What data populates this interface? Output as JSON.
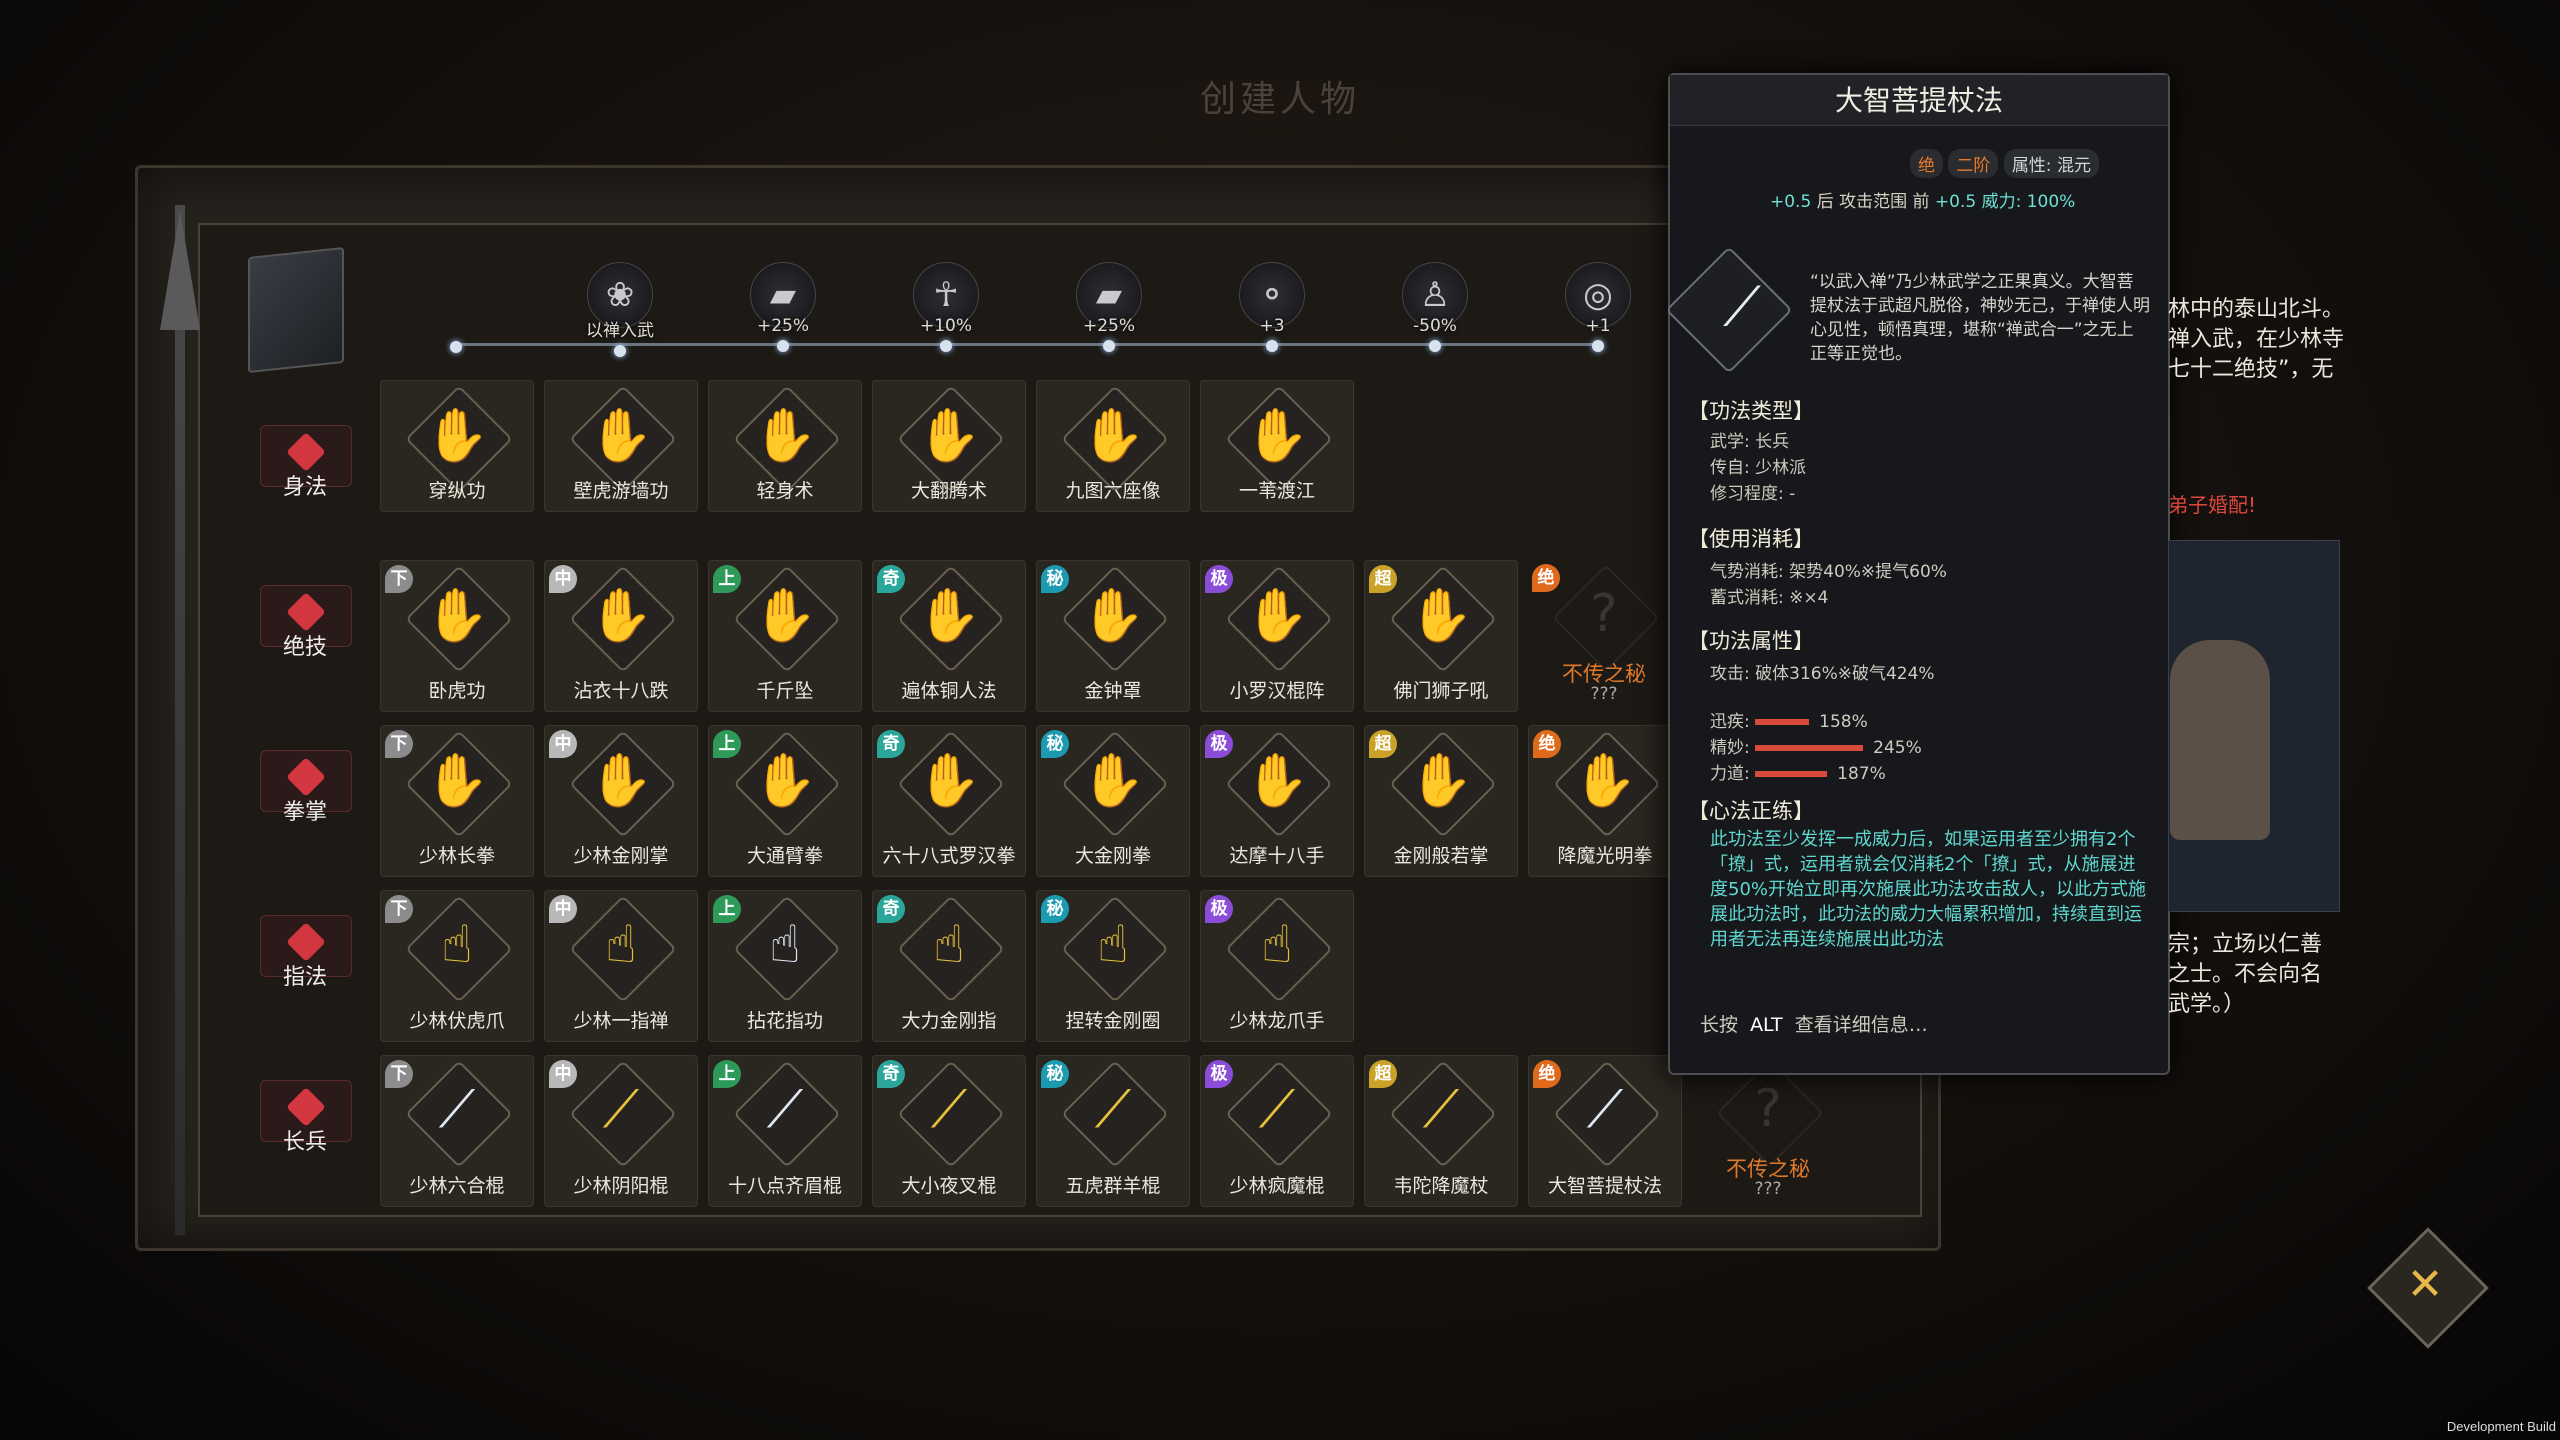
{
  "page_title": "创建人物",
  "stages": [
    {
      "icon": "lotus-icon",
      "label": "以禅入武",
      "glyph": "❀"
    },
    {
      "icon": "book-icon",
      "label": "+25%",
      "glyph": "▰"
    },
    {
      "icon": "meditation-icon",
      "label": "+10%",
      "glyph": "☥"
    },
    {
      "icon": "scroll-icon",
      "label": "+25%",
      "glyph": "▰"
    },
    {
      "icon": "nodes-icon",
      "label": "+3",
      "glyph": "⚬"
    },
    {
      "icon": "figure-icon",
      "label": "-50%",
      "glyph": "♙"
    },
    {
      "icon": "cloud-icon",
      "label": "+1",
      "glyph": "◎"
    }
  ],
  "categories": [
    "身法",
    "绝技",
    "拳掌",
    "指法",
    "长兵"
  ],
  "tiers": {
    "xia": "下",
    "zhong": "中",
    "shang": "上",
    "qi": "奇",
    "mi": "秘",
    "ji": "极",
    "chao": "超",
    "jue": "绝"
  },
  "tier_colors": {
    "下": "#8c8c8c",
    "中": "#b8b8b8",
    "上": "#2e9a5a",
    "奇": "#2aa79a",
    "秘": "#1c9bb0",
    "极": "#8b4dd8",
    "超": "#c9a227",
    "绝": "#e06a1c"
  },
  "rows": [
    {
      "category": "身法",
      "cards": [
        {
          "name": "穿纵功",
          "tier": "",
          "style": "white"
        },
        {
          "name": "壁虎游墙功",
          "tier": "",
          "style": "gold"
        },
        {
          "name": "轻身术",
          "tier": "",
          "style": "gold"
        },
        {
          "name": "大翻腾术",
          "tier": "",
          "style": "gold"
        },
        {
          "name": "九图六座像",
          "tier": "",
          "style": "gold"
        },
        {
          "name": "一苇渡江",
          "tier": "",
          "style": "white"
        }
      ]
    },
    {
      "category": "绝技",
      "cards": [
        {
          "name": "卧虎功",
          "tier": "下",
          "style": "gold"
        },
        {
          "name": "沾衣十八跌",
          "tier": "中",
          "style": "white"
        },
        {
          "name": "千斤坠",
          "tier": "上",
          "style": "gold"
        },
        {
          "name": "遍体铜人法",
          "tier": "奇",
          "style": "gold"
        },
        {
          "name": "金钟罩",
          "tier": "秘",
          "style": "gold"
        },
        {
          "name": "小罗汉棍阵",
          "tier": "极",
          "style": "gold"
        },
        {
          "name": "佛门狮子吼",
          "tier": "超",
          "style": "gold"
        },
        {
          "name": "不传之秘",
          "tier": "绝",
          "style": "secret",
          "q": "???"
        }
      ]
    },
    {
      "category": "拳掌",
      "cards": [
        {
          "name": "少林长拳",
          "tier": "下",
          "style": "gold"
        },
        {
          "name": "少林金刚掌",
          "tier": "中",
          "style": "gold"
        },
        {
          "name": "大通臂拳",
          "tier": "上",
          "style": "gold"
        },
        {
          "name": "六十八式罗汉拳",
          "tier": "奇",
          "style": "gold"
        },
        {
          "name": "大金刚拳",
          "tier": "秘",
          "style": "gold"
        },
        {
          "name": "达摩十八手",
          "tier": "极",
          "style": "gold"
        },
        {
          "name": "金刚般若掌",
          "tier": "超",
          "style": "gold"
        },
        {
          "name": "降魔光明拳",
          "tier": "绝",
          "style": "gold"
        }
      ]
    },
    {
      "category": "指法",
      "cards": [
        {
          "name": "少林伏虎爪",
          "tier": "下",
          "style": "gold"
        },
        {
          "name": "少林一指禅",
          "tier": "中",
          "style": "gold"
        },
        {
          "name": "拈花指功",
          "tier": "上",
          "style": "white"
        },
        {
          "name": "大力金刚指",
          "tier": "奇",
          "style": "gold"
        },
        {
          "name": "捏转金刚圈",
          "tier": "秘",
          "style": "gold"
        },
        {
          "name": "少林龙爪手",
          "tier": "极",
          "style": "gold"
        }
      ]
    },
    {
      "category": "长兵",
      "cards": [
        {
          "name": "少林六合棍",
          "tier": "下",
          "style": "white"
        },
        {
          "name": "少林阴阳棍",
          "tier": "中",
          "style": "gold"
        },
        {
          "name": "十八点齐眉棍",
          "tier": "上",
          "style": "white"
        },
        {
          "name": "大小夜叉棍",
          "tier": "奇",
          "style": "gold"
        },
        {
          "name": "五虎群羊棍",
          "tier": "秘",
          "style": "gold"
        },
        {
          "name": "少林疯魔棍",
          "tier": "极",
          "style": "gold"
        },
        {
          "name": "韦陀降魔杖",
          "tier": "超",
          "style": "gold"
        },
        {
          "name": "大智菩提杖法",
          "tier": "绝",
          "style": "white"
        },
        {
          "name": "不传之秘",
          "tier": "",
          "style": "secret",
          "q": "???"
        }
      ]
    }
  ],
  "tooltip": {
    "title": "大智菩提杖法",
    "tier": "绝",
    "grade": "二阶",
    "attribute_label": "属性: 混元",
    "range_back": "+0.5",
    "back": "后",
    "range_label": "攻击范围",
    "front": "前",
    "range_front": "+0.5",
    "power": "威力: 100%",
    "desc": "“以武入禅”乃少林武学之正果真义。大智菩提杖法于武超凡脱俗，神妙无己，于禅使人明心见性，顿悟真理，堪称“禅武合一”之无上正等正觉也。",
    "sec1": "【功法类型】",
    "type_items": [
      "武学: 长兵",
      "传自: 少林派",
      "修习程度: -"
    ],
    "sec2": "【使用消耗】",
    "cost_items": [
      "气势消耗: 架势40%※提气60%",
      "蓄式消耗: ※×4"
    ],
    "sec3": "【功法属性】",
    "attack": "攻击: 破体316%※破气424%",
    "stats": [
      {
        "label": "迅疾:",
        "value": "158%",
        "fill": 0.3
      },
      {
        "label": "精妙:",
        "value": "245%",
        "fill": 0.6
      },
      {
        "label": "力道:",
        "value": "187%",
        "fill": 0.4
      }
    ],
    "sec4": "【心法正练】",
    "para": "此功法至少发挥一成威力后，如果运用者至少拥有2个「撩」式，运用者就会仅消耗2个「撩」式，从施展进度50%开始立即再次施展此功法攻击敌人，以此方式施展此功法时，此功法的威力大幅累积增加，持续直到运用者无法再连续施展出此功法",
    "foot_hold": "长按",
    "foot_key": "ALT",
    "foot_more": "查看详细信息…"
  },
  "right_panel": {
    "lines": [
      "林中的泰山北斗。",
      "禅入武，在少林寺",
      "七十二绝技”，无"
    ],
    "warn": "弟子婚配!",
    "bottom": [
      "宗；立场以仁善",
      "之士。不会向名",
      "武学。）"
    ]
  },
  "dev_label": "Development Build"
}
